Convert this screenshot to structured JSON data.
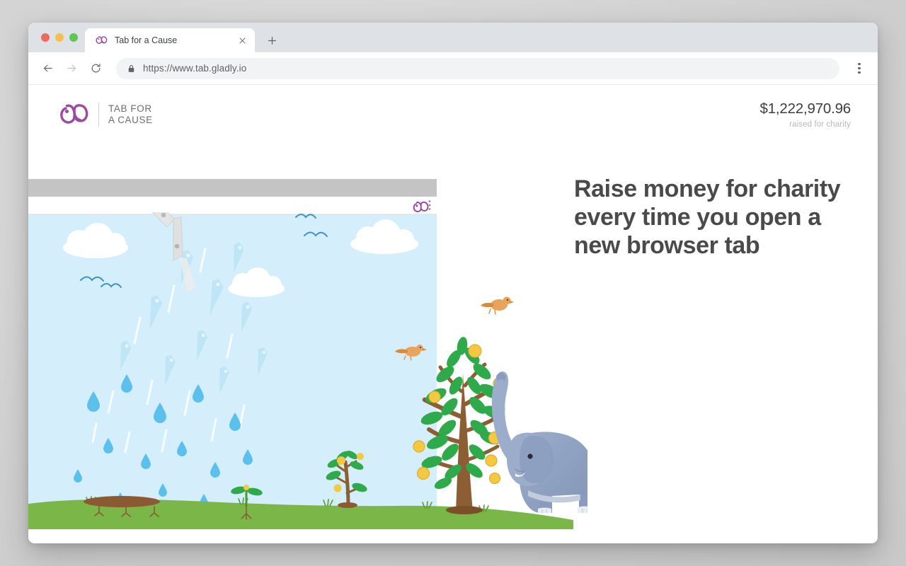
{
  "browser": {
    "tab": {
      "title": "Tab for a Cause",
      "favicon_icon": "tab-for-a-cause-elephant-icon",
      "close_icon": "close-icon"
    },
    "new_tab_icon": "plus-icon",
    "nav": {
      "back_icon": "arrow-left-icon",
      "forward_icon": "arrow-right-icon",
      "reload_icon": "reload-icon"
    },
    "omnibox": {
      "lock_icon": "lock-icon",
      "url": "https://www.tab.gladly.io"
    },
    "menu_icon": "three-dot-menu-icon",
    "traffic_lights": {
      "close_color": "#ed6a5e",
      "minimize_color": "#f5bf4f",
      "maximize_color": "#61c454"
    }
  },
  "site": {
    "brand": {
      "logo_icon": "elephant-logo-icon",
      "name_line1": "TAB FOR",
      "name_line2": "A CAUSE",
      "brand_color": "#8e3f97"
    },
    "counter": {
      "amount": "$1,222,970.96",
      "label": "raised for charity"
    },
    "headline": "Raise money for charity every time you open a new browser tab",
    "illustration": {
      "inner_browser": {
        "extension_icon": "tab-for-a-cause-elephant-icon",
        "menu_icon": "three-dot-menu-icon"
      },
      "scene_description": "Browser tabs falling as raindrops watering plants that grow into a coin tree with an elephant",
      "colors": {
        "sky": "#d4eefb",
        "grass": "#7ab648",
        "soil": "#8b5a32",
        "leaf": "#2faa4a",
        "trunk": "#8b5e34",
        "coin": "#f5c842",
        "elephant": "#94a3c4",
        "raindrop": "#58b6e8",
        "cloud": "#ffffff",
        "bird": "#e8a45c"
      }
    }
  }
}
